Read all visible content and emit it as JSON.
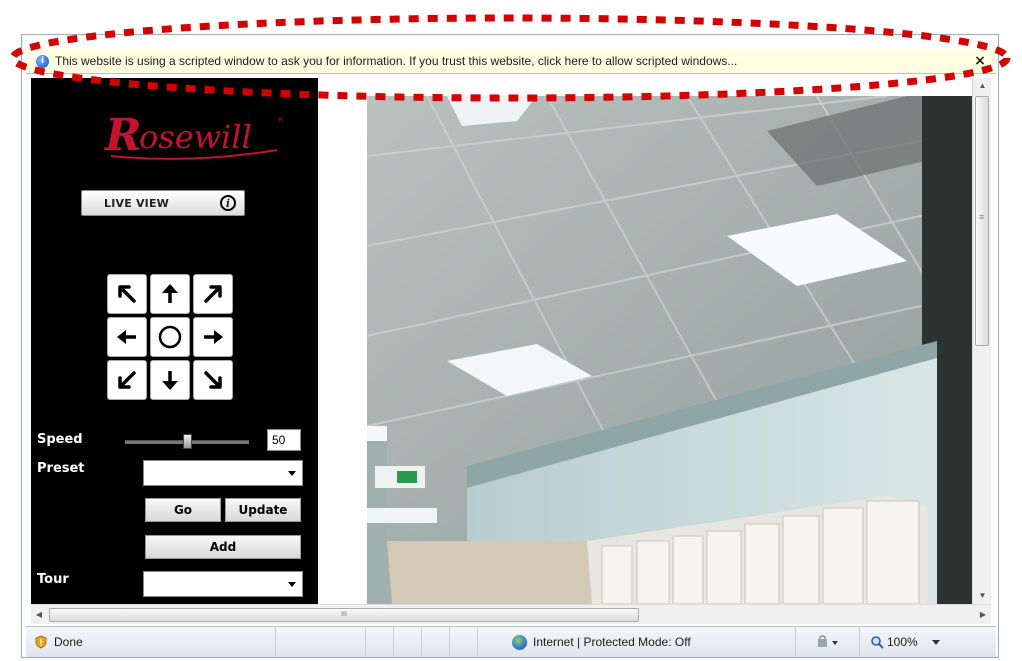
{
  "infobar": {
    "message": "This website is using a scripted window to ask you for information. If you trust this website, click here to allow scripted windows...",
    "close_label": "×",
    "info_icon": "i"
  },
  "panel": {
    "logo_text": "Rosewill",
    "logo_color": "#c4122f",
    "live_view_label": "LIVE VIEW",
    "live_view_icon": "i",
    "ptz_buttons": [
      "up-left",
      "up",
      "up-right",
      "left",
      "home",
      "right",
      "down-left",
      "down",
      "down-right"
    ],
    "speed_label": "Speed",
    "speed_value": "50",
    "speed_level": 0.5,
    "preset_label": "Preset",
    "preset_selected": "",
    "go_label": "Go",
    "update_label": "Update",
    "add_label": "Add",
    "tour_label": "Tour",
    "tour_selected": ""
  },
  "hscroll_grip": "III",
  "vscroll_grip": "≡",
  "status": {
    "left_text": "Done",
    "zone_text": "Internet | Protected Mode: Off",
    "zoom_text": "100%"
  }
}
